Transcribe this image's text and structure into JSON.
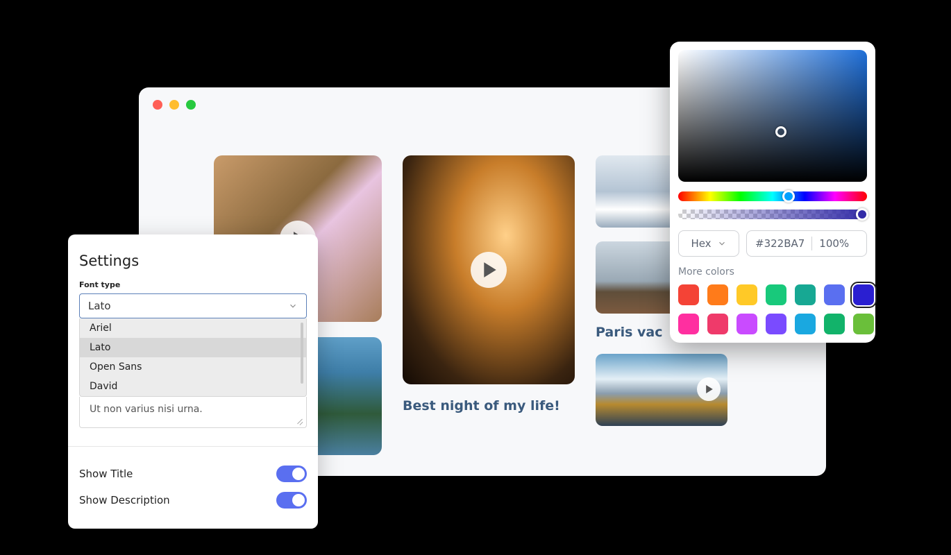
{
  "browser": {
    "cards": {
      "center_caption": "Best night of my life!",
      "right_caption": "Paris vac"
    }
  },
  "settings": {
    "title": "Settings",
    "font_type_label": "Font type",
    "font_selected": "Lato",
    "font_options": [
      "Ariel",
      "Lato",
      "Open Sans",
      "David"
    ],
    "textarea_value": "Ut non varius nisi urna.",
    "show_title_label": "Show Title",
    "show_title_on": true,
    "show_description_label": "Show Description",
    "show_description_on": true
  },
  "picker": {
    "mode_label": "Hex",
    "hex_value": "#322BA7",
    "opacity_label": "100%",
    "more_colors_label": "More colors",
    "swatches": [
      {
        "color": "#f44336",
        "selected": false
      },
      {
        "color": "#ff7b1a",
        "selected": false
      },
      {
        "color": "#ffc927",
        "selected": false
      },
      {
        "color": "#18c97b",
        "selected": false
      },
      {
        "color": "#17a893",
        "selected": false
      },
      {
        "color": "#5a6ff0",
        "selected": false
      },
      {
        "color": "#2a1fd1",
        "selected": true
      },
      {
        "color": "#ff2fa0",
        "selected": false
      },
      {
        "color": "#ef3a6a",
        "selected": false
      },
      {
        "color": "#c94bff",
        "selected": false
      },
      {
        "color": "#7a4bff",
        "selected": false
      },
      {
        "color": "#1aa8e0",
        "selected": false
      },
      {
        "color": "#12b36a",
        "selected": false
      },
      {
        "color": "#6abf3a",
        "selected": false
      }
    ]
  }
}
